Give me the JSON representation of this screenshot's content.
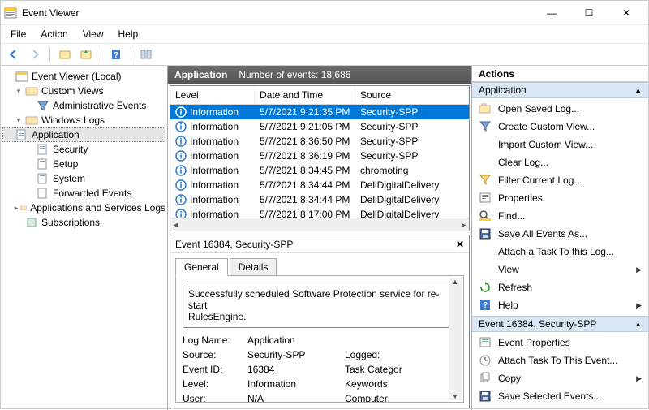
{
  "titlebar": {
    "title": "Event Viewer"
  },
  "menubar": [
    "File",
    "Action",
    "View",
    "Help"
  ],
  "tree": {
    "root": "Event Viewer (Local)",
    "custom": "Custom Views",
    "admin": "Administrative Events",
    "winlogs": "Windows Logs",
    "app": "Application",
    "sec": "Security",
    "setup": "Setup",
    "sys": "System",
    "fwd": "Forwarded Events",
    "asl": "Applications and Services Logs",
    "subs": "Subscriptions"
  },
  "gridHeader": {
    "title": "Application",
    "count": "Number of events: 18,686"
  },
  "columns": {
    "level": "Level",
    "date": "Date and Time",
    "source": "Source"
  },
  "events": [
    {
      "level": "Information",
      "date": "5/7/2021 9:21:35 PM",
      "source": "Security-SPP",
      "selected": true
    },
    {
      "level": "Information",
      "date": "5/7/2021 9:21:05 PM",
      "source": "Security-SPP"
    },
    {
      "level": "Information",
      "date": "5/7/2021 8:36:50 PM",
      "source": "Security-SPP"
    },
    {
      "level": "Information",
      "date": "5/7/2021 8:36:19 PM",
      "source": "Security-SPP"
    },
    {
      "level": "Information",
      "date": "5/7/2021 8:34:45 PM",
      "source": "chromoting"
    },
    {
      "level": "Information",
      "date": "5/7/2021 8:34:44 PM",
      "source": "DellDigitalDelivery"
    },
    {
      "level": "Information",
      "date": "5/7/2021 8:34:44 PM",
      "source": "DellDigitalDelivery"
    },
    {
      "level": "Information",
      "date": "5/7/2021 8:17:00 PM",
      "source": "DellDigitalDelivery"
    }
  ],
  "detail": {
    "title": "Event 16384, Security-SPP",
    "tabs": {
      "general": "General",
      "details": "Details"
    },
    "message": "Successfully scheduled Software Protection service for re-start\nRulesEngine.",
    "fields": {
      "logNameL": "Log Name:",
      "logNameV": "Application",
      "sourceL": "Source:",
      "sourceV": "Security-SPP",
      "loggedL": "Logged:",
      "eventIdL": "Event ID:",
      "eventIdV": "16384",
      "taskCatL": "Task Categor",
      "levelL": "Level:",
      "levelV": "Information",
      "keywordsL": "Keywords:",
      "userL": "User:",
      "userV": "N/A",
      "computerL": "Computer:"
    }
  },
  "actions": {
    "header": "Actions",
    "group1": "Application",
    "group1Items": [
      {
        "label": "Open Saved Log...",
        "icon": "open"
      },
      {
        "label": "Create Custom View...",
        "icon": "filter"
      },
      {
        "label": "Import Custom View...",
        "icon": "blank"
      },
      {
        "label": "Clear Log...",
        "icon": "blank"
      },
      {
        "label": "Filter Current Log...",
        "icon": "filter2"
      },
      {
        "label": "Properties",
        "icon": "props"
      },
      {
        "label": "Find...",
        "icon": "find"
      },
      {
        "label": "Save All Events As...",
        "icon": "save"
      },
      {
        "label": "Attach a Task To this Log...",
        "icon": "blank"
      },
      {
        "label": "View",
        "icon": "blank",
        "sub": true
      },
      {
        "label": "Refresh",
        "icon": "refresh"
      },
      {
        "label": "Help",
        "icon": "help",
        "sub": true
      }
    ],
    "group2": "Event 16384, Security-SPP",
    "group2Items": [
      {
        "label": "Event Properties",
        "icon": "eprops"
      },
      {
        "label": "Attach Task To This Event...",
        "icon": "task"
      },
      {
        "label": "Copy",
        "icon": "copy",
        "sub": true
      },
      {
        "label": "Save Selected Events...",
        "icon": "save"
      }
    ]
  }
}
